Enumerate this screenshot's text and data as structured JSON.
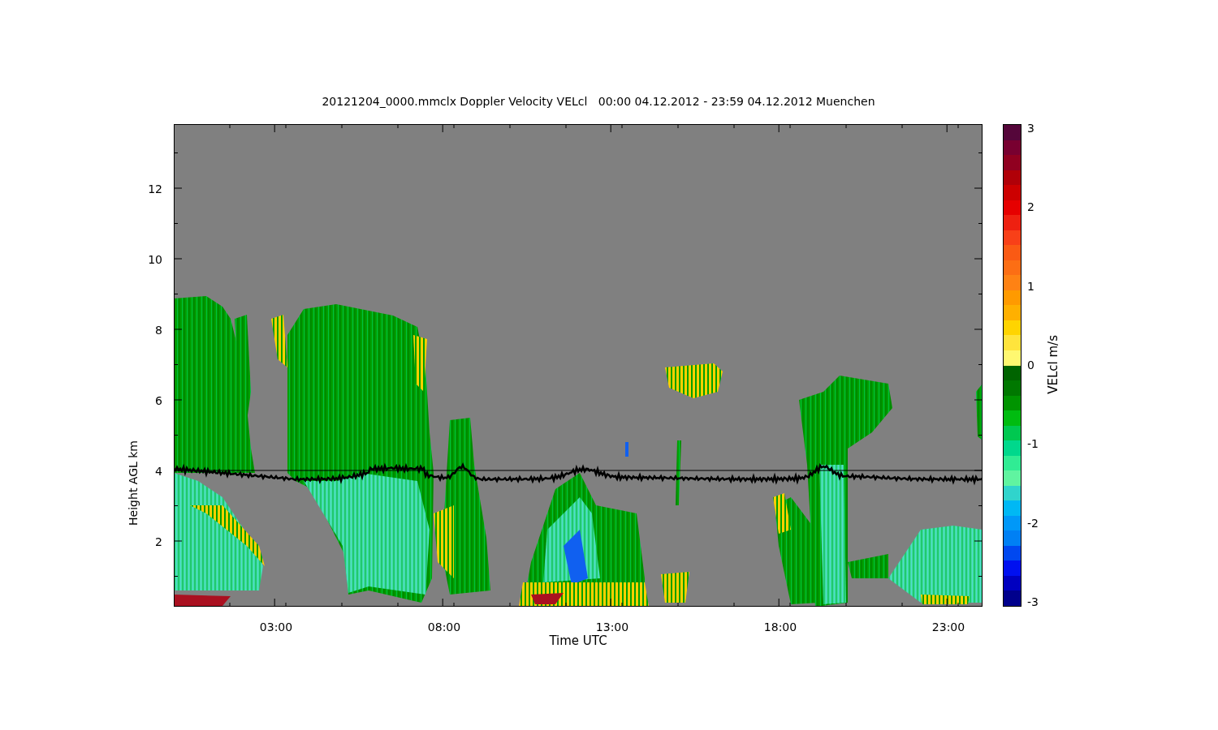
{
  "title": "20121204_0000.mmclx Doppler Velocity VELcl   00:00 04.12.2012 - 23:59 04.12.2012 Muenchen",
  "plot": {
    "ylabel": "Height AGL km",
    "xlabel": "Time UTC",
    "yticks": [
      "12",
      "10",
      "8",
      "6",
      "4",
      "2"
    ],
    "xticks": [
      "03:00",
      "08:00",
      "13:00",
      "18:00",
      "23:00"
    ]
  },
  "colorbar": {
    "label": "VELcl m/s",
    "tick_labels": [
      "3",
      "2",
      "1",
      "0",
      "-1",
      "-2",
      "-3"
    ],
    "colors": [
      {
        "color": "#55063a"
      },
      {
        "color": "#780030"
      },
      {
        "color": "#900020"
      },
      {
        "color": "#b00008"
      },
      {
        "color": "#cc0000"
      },
      {
        "color": "#e60000"
      },
      {
        "color": "#ee2010"
      },
      {
        "color": "#f84018"
      },
      {
        "color": "#fa5a14"
      },
      {
        "color": "#fc6e14"
      },
      {
        "color": "#fe8214"
      },
      {
        "color": "#ff9a00"
      },
      {
        "color": "#ffb000"
      },
      {
        "color": "#ffd400"
      },
      {
        "color": "#ffe43c"
      },
      {
        "color": "#fff870"
      },
      {
        "color": "#006400"
      },
      {
        "color": "#007800"
      },
      {
        "color": "#009400"
      },
      {
        "color": "#00bc10"
      },
      {
        "color": "#00c850"
      },
      {
        "color": "#00d88c"
      },
      {
        "color": "#30ec94"
      },
      {
        "color": "#60f4a0"
      },
      {
        "color": "#30d4cc"
      },
      {
        "color": "#00b8f4"
      },
      {
        "color": "#0098f8"
      },
      {
        "color": "#0080f4"
      },
      {
        "color": "#0048f0"
      },
      {
        "color": "#0010f0"
      },
      {
        "color": "#0000c0"
      },
      {
        "color": "#00008c"
      }
    ]
  }
}
